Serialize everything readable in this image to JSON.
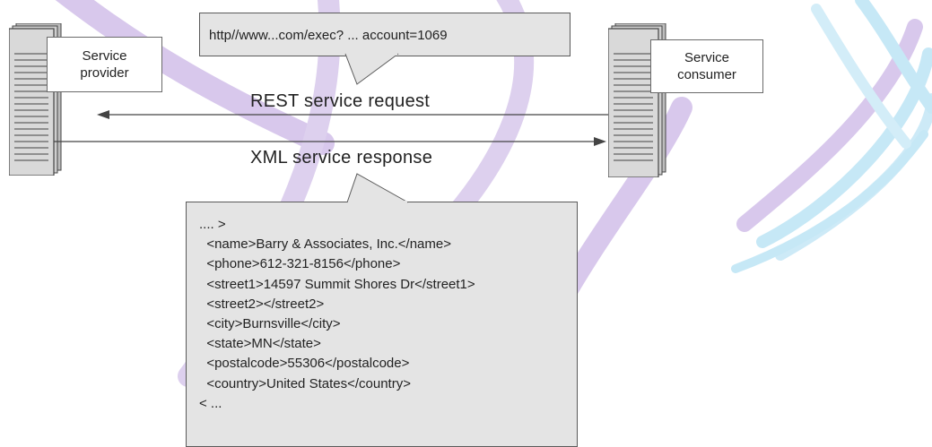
{
  "provider": {
    "label_line1": "Service",
    "label_line2": "provider"
  },
  "consumer": {
    "label_line1": "Service",
    "label_line2": "consumer"
  },
  "request": {
    "url": "http//www...com/exec? ... account=1069",
    "label": "REST service request"
  },
  "response": {
    "label": "XML service response",
    "lines": [
      ".... >",
      "  <name>Barry & Associates, Inc.</name>",
      "  <phone>612-321-8156</phone>",
      "  <street1>14597 Summit Shores Dr</street1>",
      "  <street2></street2>",
      "  <city>Burnsville</city>",
      "  <state>MN</state>",
      "  <postalcode>55306</postalcode>",
      "  <country>United States</country>",
      "< ..."
    ]
  },
  "colors": {
    "callout_fill": "#e4e4e4",
    "server_fill": "#d9d9d9",
    "watermark_purple": "#d8c8ec",
    "watermark_blue": "#c6e8f6"
  }
}
